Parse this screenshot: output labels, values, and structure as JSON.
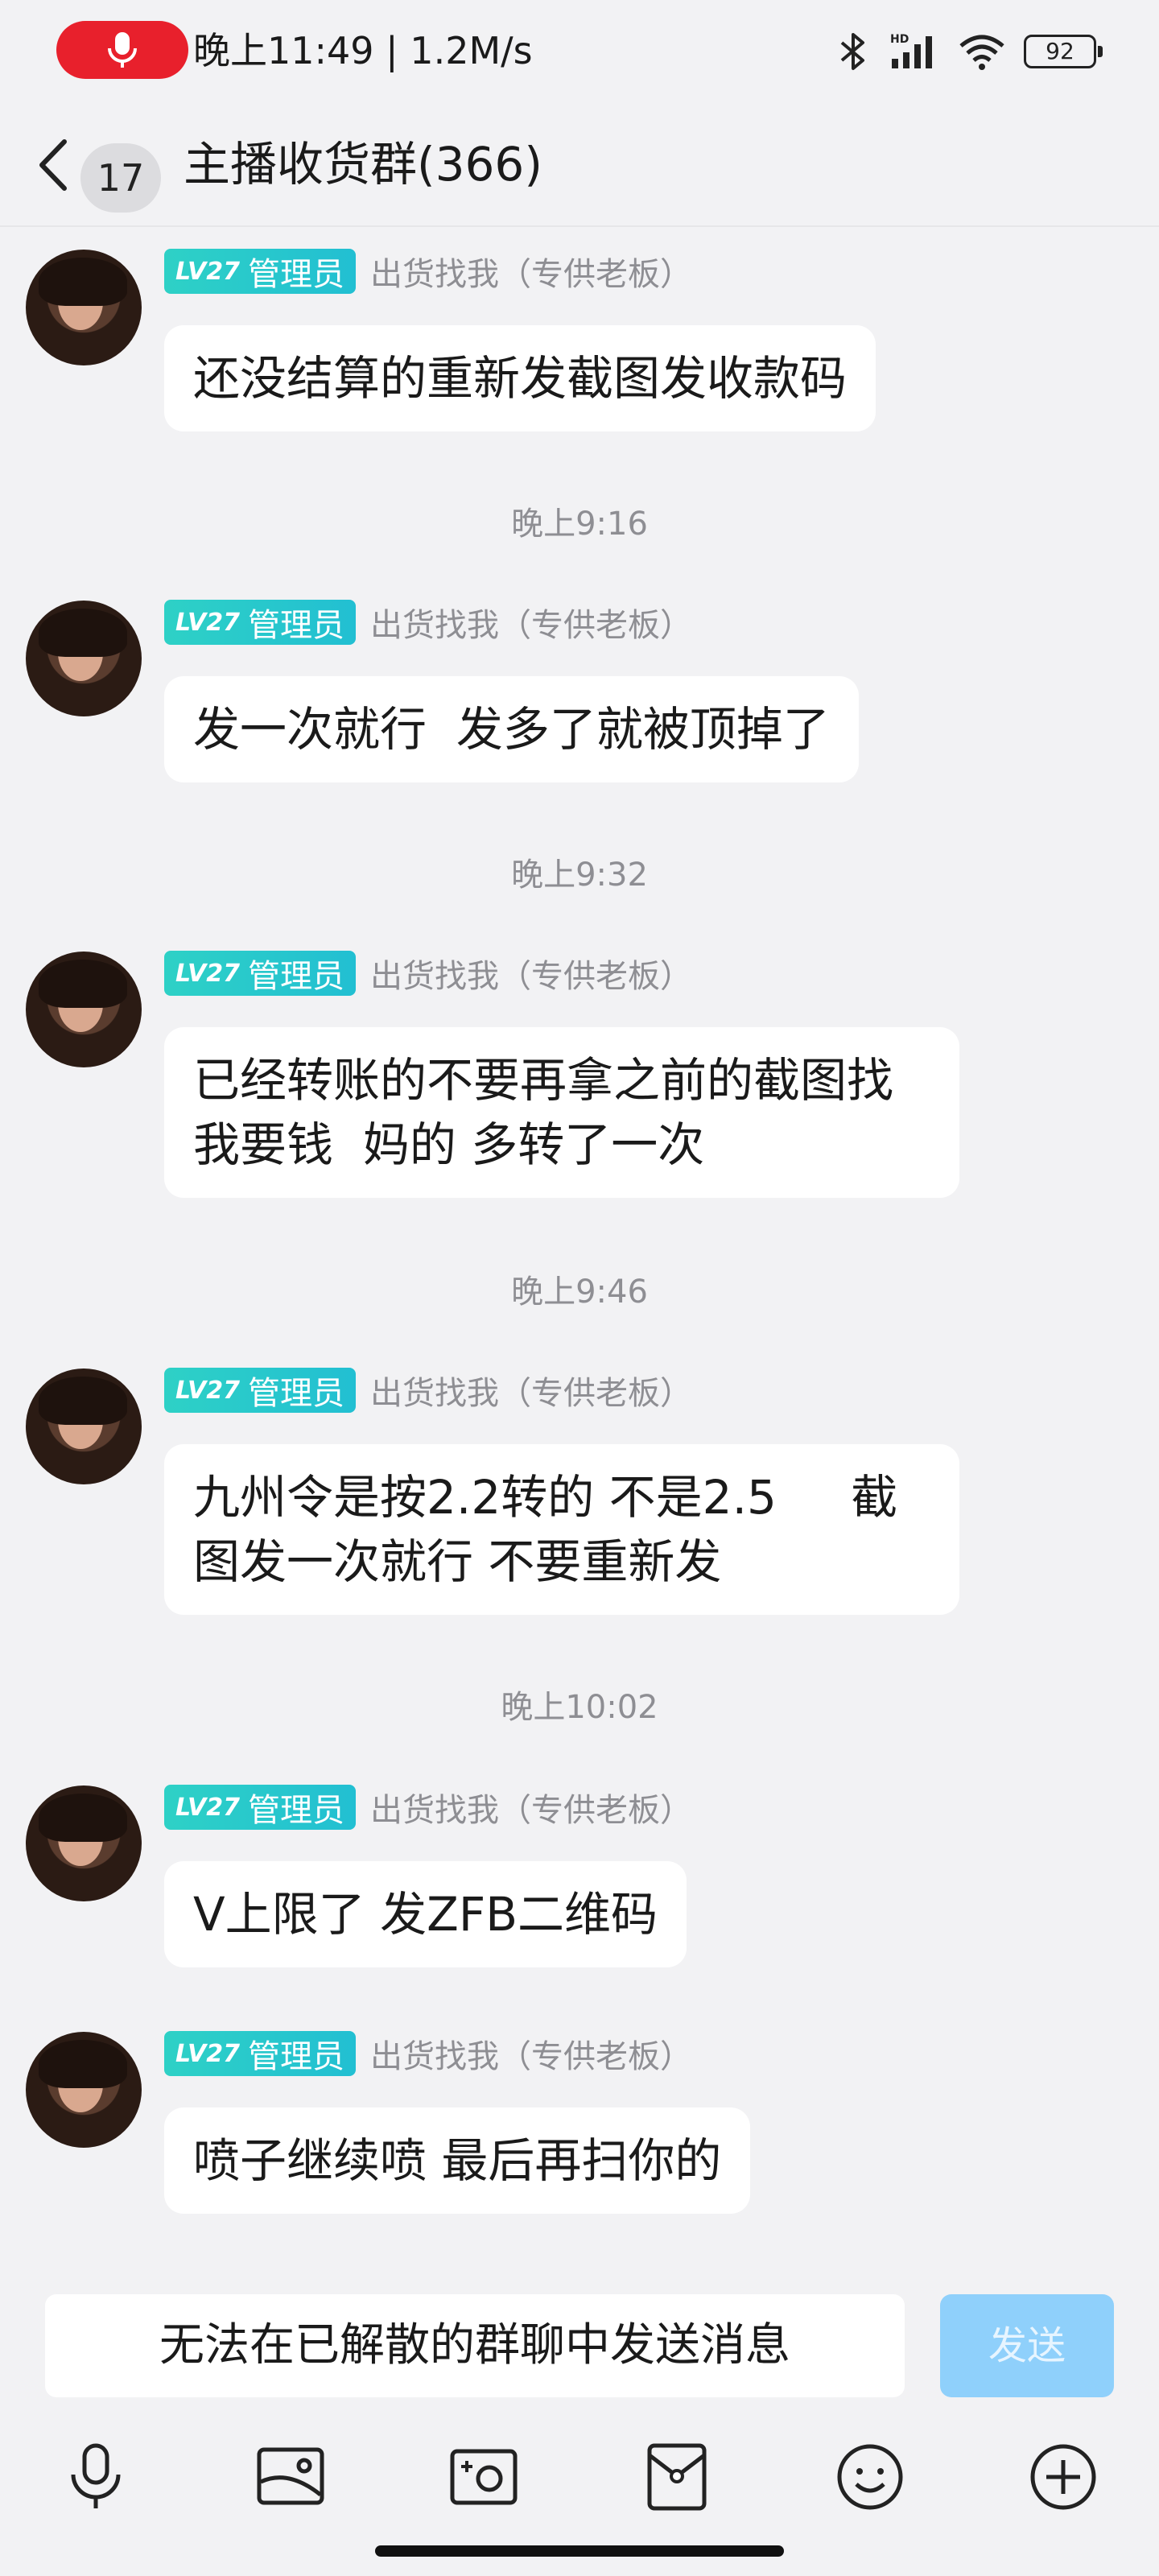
{
  "status_bar": {
    "text": "晚上11:49 | 1.2M/s",
    "battery": "92"
  },
  "header": {
    "unread_count": "17",
    "title": "主播收货群(366)"
  },
  "sender": {
    "level": "LV27",
    "role": "管理员",
    "name": "出货找我（专供老板）"
  },
  "messages": [
    {
      "text": "还没结算的重新发截图发收款码"
    },
    {
      "time": "晚上9:16",
      "text": "发一次就行  发多了就被顶掉了"
    },
    {
      "time": "晚上9:32",
      "text": "已经转账的不要再拿之前的截图找\n我要钱  妈的 多转了一次"
    },
    {
      "time": "晚上9:46",
      "text": "九州令是按2.2转的 不是2.5     截\n图发一次就行 不要重新发"
    },
    {
      "time": "晚上10:02",
      "text": "V上限了 发ZFB二维码"
    },
    {
      "text": "喷子继续喷 最后再扫你的"
    }
  ],
  "input": {
    "disabled_text": "无法在已解散的群聊中发送消息",
    "send_label": "发送"
  },
  "toolbar": [
    "microphone-icon",
    "image-icon",
    "camera-icon",
    "red-packet-icon",
    "emoji-icon",
    "plus-icon"
  ],
  "colors": {
    "accent_teal": "#2ed1c6",
    "send_disabled": "#8fd0fb",
    "recording_red": "#e8202c"
  }
}
